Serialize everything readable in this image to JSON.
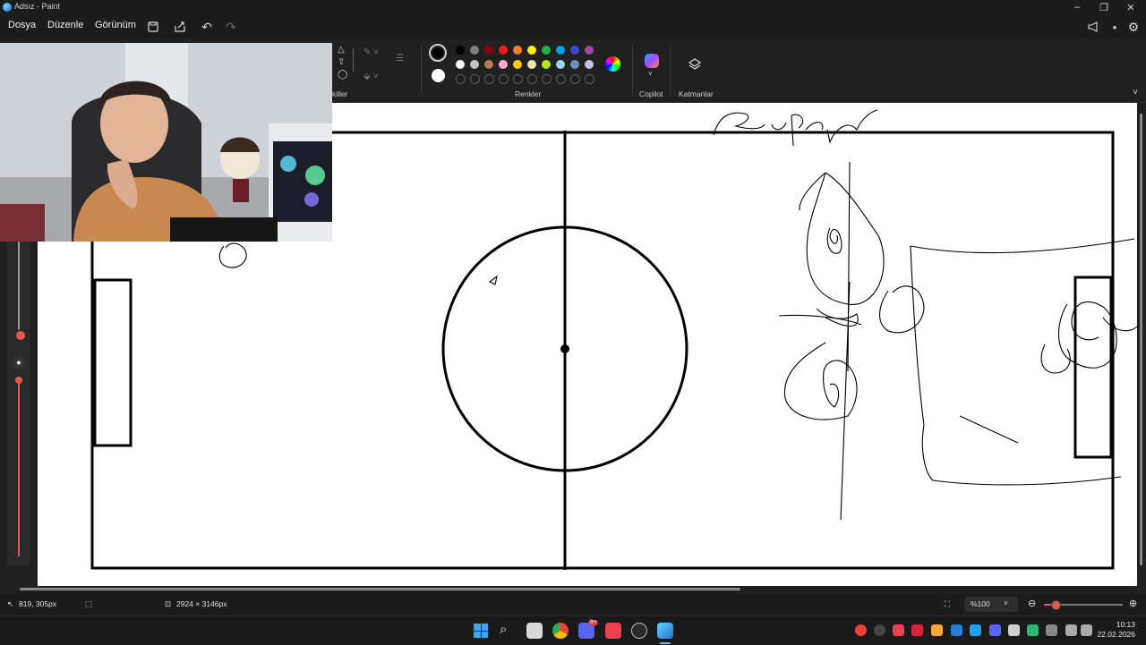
{
  "window": {
    "title": "Adsız - Paint",
    "controls": [
      "minimize-icon",
      "restore-icon",
      "close-icon"
    ]
  },
  "menu": {
    "items": [
      "Dosya",
      "Düzenle",
      "Görünüm"
    ],
    "toolbar_icons": [
      "save-icon",
      "share-icon",
      "undo-icon",
      "redo-icon"
    ],
    "right_icons": [
      "megaphone-icon",
      "account-icon",
      "settings-icon"
    ]
  },
  "ribbon": {
    "shapes_label": "killer",
    "colors_label": "Renkler",
    "copilot_label": "Copilot",
    "layers_label": "Katmanlar",
    "primary_color": "#000000",
    "secondary_color": "#ffffff",
    "palette_row1": [
      "#000000",
      "#7f7f7f",
      "#880015",
      "#ed1c24",
      "#ff7f27",
      "#fff200",
      "#22b14c",
      "#00a2e8",
      "#3f48cc",
      "#a349a4"
    ],
    "palette_row2": [
      "#ffffff",
      "#c3c3c3",
      "#b97a57",
      "#ffaec9",
      "#ffc90e",
      "#efe4b0",
      "#b5e61d",
      "#99d9ea",
      "#7092be",
      "#c8bfe7"
    ]
  },
  "status": {
    "cursor_pos": "819, 305px",
    "canvas_size": "2924 × 3146px",
    "zoom": "%100"
  },
  "taskbar": {
    "apps": [
      "windows-start-icon",
      "search-icon",
      "file-explorer-icon",
      "chrome-icon",
      "discord-icon",
      "valorant-icon",
      "steam-icon",
      "paint-icon"
    ],
    "discord_badge": "9+",
    "time": "10:13",
    "date": "22.02.2026"
  }
}
